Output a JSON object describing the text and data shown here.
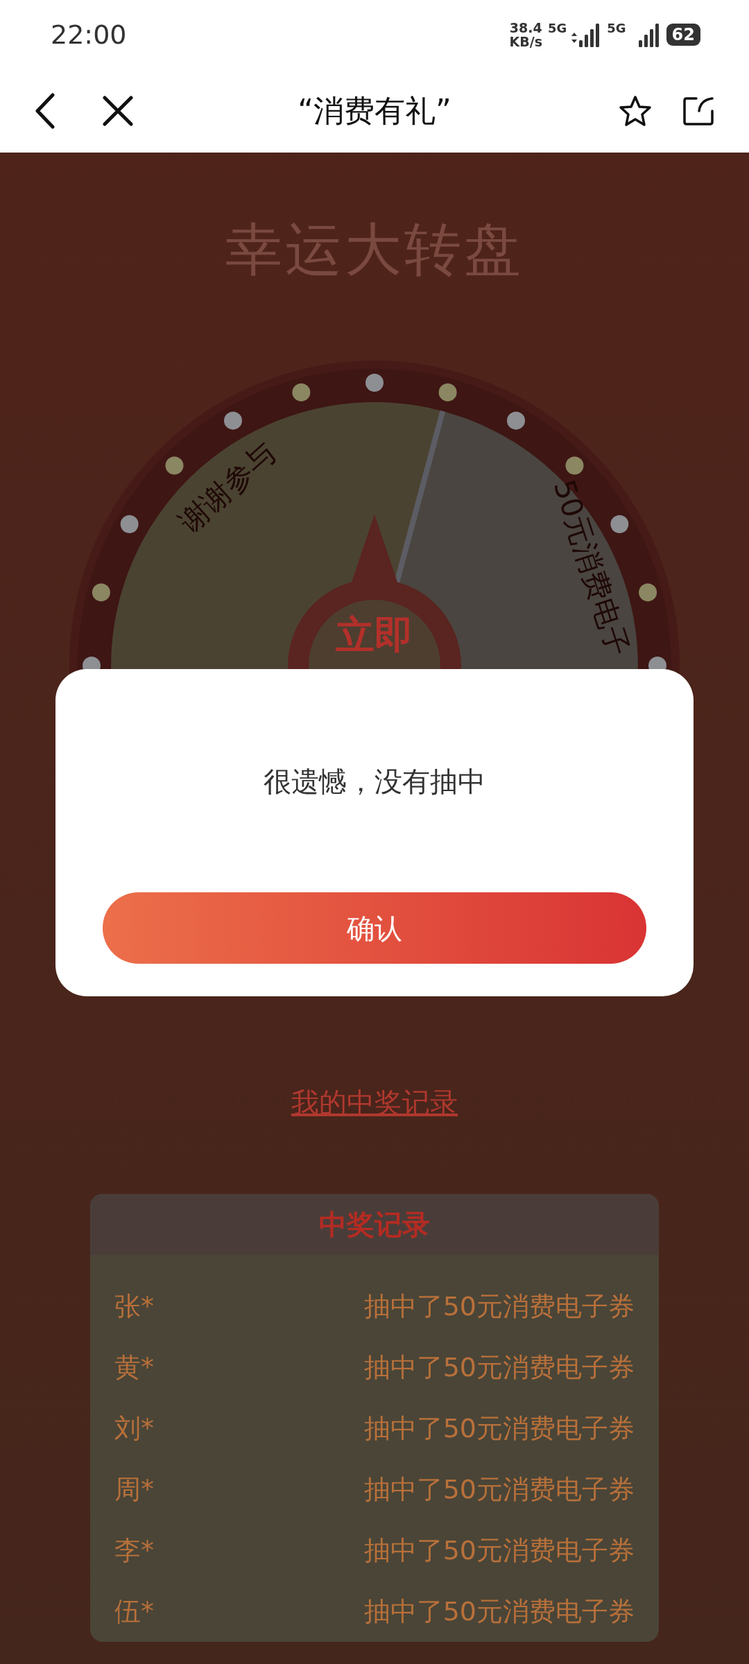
{
  "status_bar": {
    "time": "22:00",
    "net_speed": [
      "38.4",
      "KB/s"
    ],
    "signals": [
      "5G",
      "5G"
    ],
    "battery": "62"
  },
  "nav": {
    "title": "“消费有礼”"
  },
  "page": {
    "title": "幸运大转盘",
    "wheel": {
      "segments": [
        {
          "label": "谢谢参与"
        },
        {
          "label": "50元消费电子"
        }
      ],
      "spin_button": "立即"
    },
    "my_records_link": "我的中奖记录",
    "records": {
      "title": "中奖记录",
      "rows": [
        {
          "name": "张*",
          "prize": "抽中了50元消费电子券"
        },
        {
          "name": "黄*",
          "prize": "抽中了50元消费电子券"
        },
        {
          "name": "刘*",
          "prize": "抽中了50元消费电子券"
        },
        {
          "name": "周*",
          "prize": "抽中了50元消费电子券"
        },
        {
          "name": "李*",
          "prize": "抽中了50元消费电子券"
        },
        {
          "name": "伍*",
          "prize": "抽中了50元消费电子券"
        }
      ]
    }
  },
  "dialog": {
    "message": "很遗憾，没有抽中",
    "confirm": "确认"
  }
}
